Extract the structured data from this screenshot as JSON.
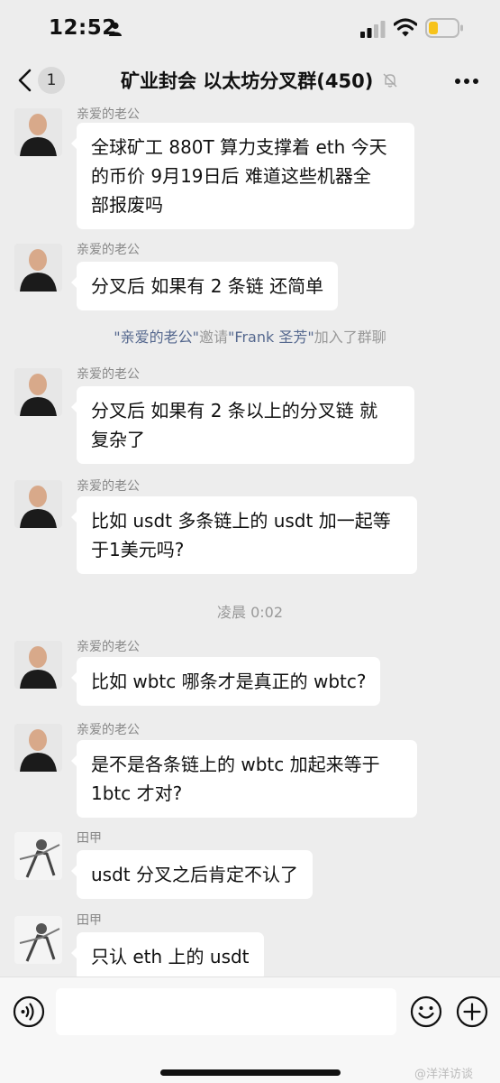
{
  "status_bar": {
    "time": "12:52"
  },
  "header": {
    "back_badge": "1",
    "title": "矿业封会 以太坊分叉群(450)"
  },
  "messages": [
    {
      "sender": "亲爱的老公",
      "lines": [
        "全球矿工 880T 算力支撑着 eth 今天",
        "的币价 9月19日后 难道这些机器全",
        "部报废吗"
      ]
    },
    {
      "sender": "亲爱的老公",
      "lines": [
        "分叉后 如果有 2 条链 还简单"
      ]
    },
    {
      "sender": "亲爱的老公",
      "lines": [
        "分叉后 如果有 2 条以上的分叉链 就",
        "复杂了"
      ]
    },
    {
      "sender": "亲爱的老公",
      "lines": [
        "比如 usdt 多条链上的 usdt 加一起等",
        "于1美元吗?"
      ]
    },
    {
      "sender": "亲爱的老公",
      "lines": [
        "比如 wbtc 哪条才是真正的 wbtc?"
      ]
    },
    {
      "sender": "亲爱的老公",
      "lines": [
        "是不是各条链上的 wbtc 加起来等于",
        "1btc 才对?"
      ]
    },
    {
      "sender": "田甲",
      "lines": [
        "usdt 分叉之后肯定不认了"
      ]
    },
    {
      "sender": "田甲",
      "lines": [
        "只认 eth 上的 usdt"
      ]
    }
  ],
  "system_notice": {
    "inviter": "\"亲爱的老公\"",
    "invite_word": "邀请",
    "invitee": "\"Frank 圣芳\"",
    "suffix": "加入了群聊"
  },
  "time_divider": "凌晨 0:02",
  "watermark": "@洋洋访谈",
  "icons": {
    "back": "chevron-left-icon",
    "mute": "bell-off-icon",
    "more": "more-dots-icon",
    "voice": "voice-icon",
    "emoji": "emoji-icon",
    "add": "plus-circle-icon"
  },
  "colors": {
    "background": "#ededed",
    "bubble": "#ffffff",
    "system_name": "#56698f",
    "battery": "#f7c31b"
  }
}
